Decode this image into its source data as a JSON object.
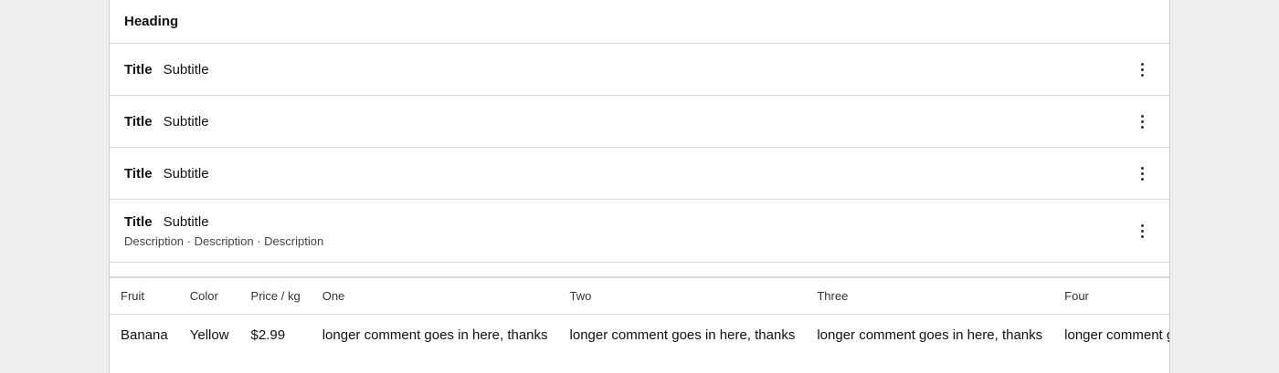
{
  "list": {
    "heading": "Heading",
    "rows": [
      {
        "title": "Title",
        "subtitle": "Subtitle"
      },
      {
        "title": "Title",
        "subtitle": "Subtitle"
      },
      {
        "title": "Title",
        "subtitle": "Subtitle"
      },
      {
        "title": "Title",
        "subtitle": "Subtitle",
        "description": "Description · Description · Description"
      }
    ],
    "menu_icon": "more-vertical-icon"
  },
  "table": {
    "columns": [
      "Fruit",
      "Color",
      "Price / kg",
      "One",
      "Two",
      "Three",
      "Four"
    ],
    "rows": [
      [
        "Banana",
        "Yellow",
        "$2.99",
        "longer comment goes in here, thanks",
        "longer comment goes in here, thanks",
        "longer comment goes in here, thanks",
        "longer comment goes in here, thanks"
      ]
    ]
  }
}
